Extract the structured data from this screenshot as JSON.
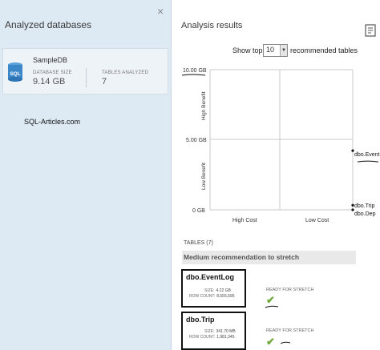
{
  "left": {
    "title": "Analyzed databases",
    "close": "×",
    "database": {
      "name": "SampleDB",
      "icon_label": "SQL",
      "size_label": "DATABASE SIZE",
      "size_value": "9.14 GB",
      "tables_label": "TABLES ANALYZED",
      "tables_value": "7"
    },
    "watermark": "SQL-Articles.com"
  },
  "right": {
    "title": "Analysis results",
    "show_top_label": "Show top",
    "top_value": "10",
    "recommended_label": "recommended tables"
  },
  "chart_data": {
    "type": "scatter",
    "y_ticks": [
      "10.00 GB",
      "5.00 GB",
      "0 GB"
    ],
    "y_axis_labels": {
      "top": "High Benefit",
      "bottom": "Low Benefit"
    },
    "x_axis_labels": {
      "left": "High Cost",
      "right": "Low Cost"
    },
    "points": [
      {
        "label": "dbo.EventLog",
        "size_gb": 4.22
      },
      {
        "label": "dbo.Trip",
        "size_gb": 0.33
      },
      {
        "label": "dbo",
        "size_gb": 0.0
      }
    ],
    "point_labels_shown": [
      "dbo.Event",
      "dbo.Trip",
      "dbo.Dep"
    ],
    "ylim": [
      0,
      10
    ],
    "colors": {
      "axis": "#c8c8c8",
      "point": "#111111",
      "check": "#6fa83a"
    }
  },
  "tables": {
    "count_label": "TABLES (7)",
    "section": "Medium recommendation to stretch",
    "items": [
      {
        "name": "dbo.EventLog",
        "size_label": "SIZE:",
        "size": "4.22 GB",
        "rows_label": "ROW COUNT:",
        "rows": "8,555,595",
        "status": "READY FOR STRETCH"
      },
      {
        "name": "dbo.Trip",
        "size_label": "SIZE:",
        "size": "341.70 MB",
        "rows_label": "ROW COUNT:",
        "rows": "1,981,345",
        "status": "READY FOR STRETCH"
      }
    ]
  }
}
